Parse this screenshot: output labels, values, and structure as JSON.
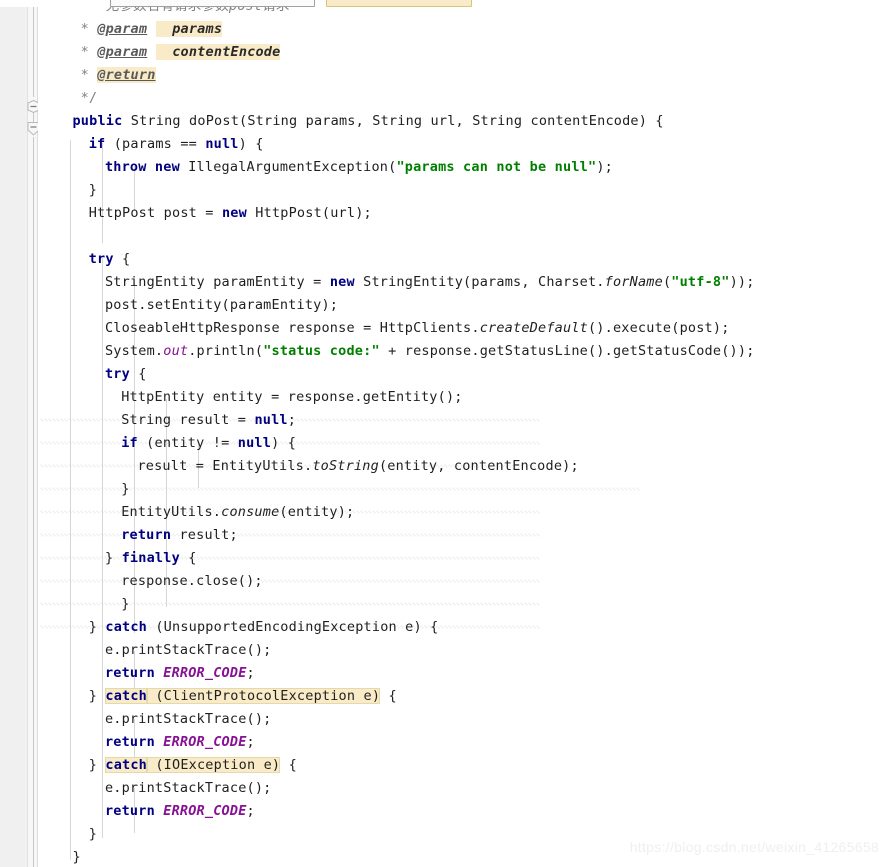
{
  "editor": {
    "language": "Java",
    "watermark": "https://blog.csdn.net/weixin_41265658",
    "colors": {
      "background": "#ffffff",
      "gutter": "#f0f0f0",
      "keyword": "#000080",
      "string": "#008000",
      "comment": "#808080",
      "static_member": "#871094",
      "highlight": "#faebc8",
      "squiggle": "#d3d3d3",
      "indent_guide": "#d6d6d6"
    },
    "fold_markers": [
      {
        "name": "fold-marker-javadoc",
        "state": "expanded",
        "shape": "hexagon-minus"
      },
      {
        "name": "fold-marker-method",
        "state": "expanded",
        "shape": "pentagon-minus"
      }
    ],
    "top_widgets": [
      {
        "name": "search-field-partial",
        "style": "gray-outline"
      },
      {
        "name": "highlight-field-partial",
        "style": "cream-outline"
      }
    ],
    "code_lines": [
      {
        "indent": 5,
        "text": "* 无参数名有请求参数post请求"
      },
      {
        "indent": 5,
        "text": "* @param params"
      },
      {
        "indent": 5,
        "text": "* @param contentEncode"
      },
      {
        "indent": 5,
        "text": "* @return"
      },
      {
        "indent": 5,
        "text": "*/"
      },
      {
        "indent": 4,
        "text": "public String doPost(String params, String url, String contentEncode) {"
      },
      {
        "indent": 6,
        "text": "if (params == null) {"
      },
      {
        "indent": 8,
        "text": "throw new IllegalArgumentException(\"params can not be null\");"
      },
      {
        "indent": 6,
        "text": "}"
      },
      {
        "indent": 6,
        "text": "HttpPost post = new HttpPost(url);"
      },
      {
        "indent": 6,
        "text": ""
      },
      {
        "indent": 6,
        "text": "try {"
      },
      {
        "indent": 8,
        "text": "StringEntity paramEntity = new StringEntity(params, Charset.forName(\"utf-8\"));"
      },
      {
        "indent": 8,
        "text": "post.setEntity(paramEntity);"
      },
      {
        "indent": 8,
        "text": "CloseableHttpResponse response = HttpClients.createDefault().execute(post);"
      },
      {
        "indent": 8,
        "text": "System.out.println(\"status code:\" + response.getStatusLine().getStatusCode());"
      },
      {
        "indent": 8,
        "text": "try {"
      },
      {
        "indent": 10,
        "text": "HttpEntity entity = response.getEntity();"
      },
      {
        "indent": 10,
        "text": "String result = null;"
      },
      {
        "indent": 10,
        "text": "if (entity != null) {"
      },
      {
        "indent": 12,
        "text": "result = EntityUtils.toString(entity, contentEncode);"
      },
      {
        "indent": 10,
        "text": "}"
      },
      {
        "indent": 10,
        "text": "EntityUtils.consume(entity);"
      },
      {
        "indent": 10,
        "text": "return result;"
      },
      {
        "indent": 8,
        "text": "} finally {"
      },
      {
        "indent": 10,
        "text": "response.close();"
      },
      {
        "indent": 10,
        "text": "}"
      },
      {
        "indent": 6,
        "text": "} catch (UnsupportedEncodingException e) {"
      },
      {
        "indent": 8,
        "text": "e.printStackTrace();"
      },
      {
        "indent": 8,
        "text": "return ERROR_CODE;"
      },
      {
        "indent": 6,
        "text": "} catch (ClientProtocolException e) {"
      },
      {
        "indent": 8,
        "text": "e.printStackTrace();"
      },
      {
        "indent": 8,
        "text": "return ERROR_CODE;"
      },
      {
        "indent": 6,
        "text": "} catch (IOException e) {"
      },
      {
        "indent": 8,
        "text": "e.printStackTrace();"
      },
      {
        "indent": 8,
        "text": "return ERROR_CODE;"
      },
      {
        "indent": 6,
        "text": "}"
      },
      {
        "indent": 4,
        "text": "}"
      }
    ],
    "highlighted_terms": [
      "params",
      "contentEncode",
      "@return",
      "catch (ClientProtocolException e)",
      "catch (IOException e)"
    ],
    "segments": {
      "l0": [
        [
          "cmt",
          "*  "
        ],
        [
          "cmt",
          "无参数名有请求参数"
        ],
        [
          "cmt-i",
          "post"
        ],
        [
          "cmt",
          "请求"
        ]
      ],
      "l1": [
        [
          "cmt",
          "* "
        ],
        [
          "tag",
          "@param"
        ],
        [
          "plain",
          " "
        ],
        [
          "hl",
          "  "
        ],
        [
          "tagval-hl",
          "params"
        ]
      ],
      "l2": [
        [
          "cmt",
          "* "
        ],
        [
          "tag",
          "@param"
        ],
        [
          "plain",
          " "
        ],
        [
          "hl",
          "  "
        ],
        [
          "tagval-hl",
          "contentEncode"
        ]
      ],
      "l3": [
        [
          "cmt",
          "* "
        ],
        [
          "tag-hl",
          "@return"
        ]
      ],
      "l4": [
        [
          "cmt",
          "*/"
        ]
      ],
      "l5": [
        [
          "kw",
          "public"
        ],
        [
          "plain",
          " String doPost(String params, String url, String contentEncode) {"
        ]
      ],
      "l6": [
        [
          "kw",
          "if"
        ],
        [
          "plain",
          " (params == "
        ],
        [
          "kw",
          "null"
        ],
        [
          "plain",
          ") {"
        ]
      ],
      "l7": [
        [
          "kw",
          "throw new"
        ],
        [
          "plain",
          " IllegalArgumentException("
        ],
        [
          "str",
          "\"params can not be null\""
        ],
        [
          "plain",
          ");"
        ]
      ],
      "l8": [
        [
          "plain",
          "}"
        ]
      ],
      "l9": [
        [
          "plain",
          "HttpPost post = "
        ],
        [
          "kw",
          "new"
        ],
        [
          "plain",
          " HttpPost(url);"
        ]
      ],
      "l11": [
        [
          "kw",
          "try"
        ],
        [
          "plain",
          " {"
        ]
      ],
      "l12": [
        [
          "plain",
          "StringEntity paramEntity = "
        ],
        [
          "kw",
          "new"
        ],
        [
          "plain",
          " StringEntity(params, Charset."
        ],
        [
          "mthd",
          "forName"
        ],
        [
          "plain",
          "("
        ],
        [
          "str",
          "\"utf-8\""
        ],
        [
          "plain",
          "));"
        ]
      ],
      "l13": [
        [
          "plain",
          "post.setEntity(paramEntity);"
        ]
      ],
      "l14": [
        [
          "plain",
          "CloseableHttpResponse response = HttpClients."
        ],
        [
          "mthd",
          "createDefault"
        ],
        [
          "plain",
          "().execute(post);"
        ]
      ],
      "l15": [
        [
          "plain",
          "System."
        ],
        [
          "stat",
          "out"
        ],
        [
          "plain",
          ".println("
        ],
        [
          "str",
          "\"status code:\""
        ],
        [
          "plain",
          " + response.getStatusLine().getStatusCode());"
        ]
      ],
      "l16": [
        [
          "kw",
          "try"
        ],
        [
          "plain",
          " {"
        ]
      ],
      "l17": [
        [
          "plain",
          "HttpEntity entity = response.getEntity();"
        ]
      ],
      "l18": [
        [
          "plain",
          "String result = "
        ],
        [
          "kw",
          "null"
        ],
        [
          "plain",
          ";"
        ]
      ],
      "l19": [
        [
          "kw",
          "if"
        ],
        [
          "plain",
          " (entity != "
        ],
        [
          "kw",
          "null"
        ],
        [
          "plain",
          ") {"
        ]
      ],
      "l20": [
        [
          "plain",
          "result = EntityUtils."
        ],
        [
          "mthd",
          "toString"
        ],
        [
          "plain",
          "(entity, contentEncode);"
        ]
      ],
      "l21": [
        [
          "plain",
          "}"
        ]
      ],
      "l22": [
        [
          "plain",
          "EntityUtils."
        ],
        [
          "mthd",
          "consume"
        ],
        [
          "plain",
          "(entity);"
        ]
      ],
      "l23": [
        [
          "kw",
          "return"
        ],
        [
          "plain",
          " result;"
        ]
      ],
      "l24": [
        [
          "plain",
          "} "
        ],
        [
          "kw",
          "finally"
        ],
        [
          "plain",
          " {"
        ]
      ],
      "l25": [
        [
          "plain",
          "response.close();"
        ]
      ],
      "l26": [
        [
          "plain",
          "}"
        ]
      ],
      "l27": [
        [
          "plain",
          "} "
        ],
        [
          "kw",
          "catch"
        ],
        [
          "plain",
          " (UnsupportedEncodingException e) {"
        ]
      ],
      "l28": [
        [
          "plain",
          "e.printStackTrace();"
        ]
      ],
      "l29": [
        [
          "kw",
          "return"
        ],
        [
          "plain",
          " "
        ],
        [
          "statb",
          "ERROR_CODE"
        ],
        [
          "plain",
          ";"
        ]
      ],
      "l30": [
        [
          "plain",
          "} "
        ],
        [
          "kw-hl",
          "catch"
        ],
        [
          "plain-hl",
          " (ClientProtocolException e)"
        ],
        [
          "plain",
          " {"
        ]
      ],
      "l31": [
        [
          "plain",
          "e.printStackTrace();"
        ]
      ],
      "l32": [
        [
          "kw",
          "return"
        ],
        [
          "plain",
          " "
        ],
        [
          "statb",
          "ERROR_CODE"
        ],
        [
          "plain",
          ";"
        ]
      ],
      "l33": [
        [
          "plain",
          "} "
        ],
        [
          "kw-hl",
          "catch"
        ],
        [
          "plain-hl",
          " (IOException e)"
        ],
        [
          "plain",
          " {"
        ]
      ],
      "l34": [
        [
          "plain",
          "e.printStackTrace();"
        ]
      ],
      "l35": [
        [
          "kw",
          "return"
        ],
        [
          "plain",
          " "
        ],
        [
          "statb",
          "ERROR_CODE"
        ],
        [
          "plain",
          ";"
        ]
      ],
      "l36": [
        [
          "plain",
          "}"
        ]
      ],
      "l37": [
        [
          "plain",
          "}"
        ]
      ]
    }
  }
}
